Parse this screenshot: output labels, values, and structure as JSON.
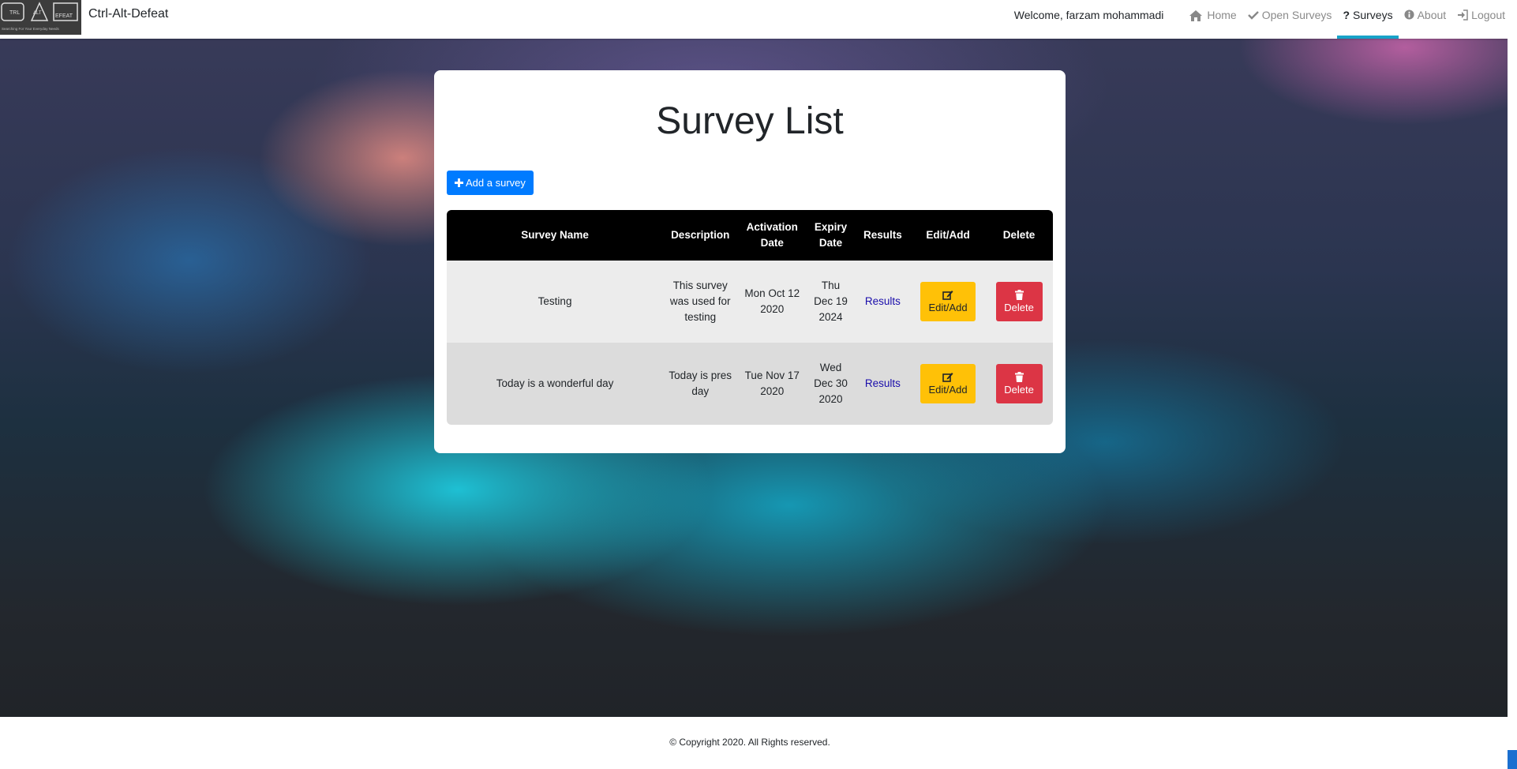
{
  "app": {
    "brand": "Ctrl-Alt-Defeat",
    "logo_text": [
      "TRL",
      "ALT",
      "EFEAT"
    ],
    "logo_tagline": "Searching For Your Everyday Needs"
  },
  "nav": {
    "welcome": "Welcome, farzam mohammadi",
    "items": [
      {
        "label": "Home",
        "icon": "home-icon"
      },
      {
        "label": "Open Surveys",
        "icon": "check-icon"
      },
      {
        "label": "Surveys",
        "icon": "question-icon",
        "active": true
      },
      {
        "label": "About",
        "icon": "info-icon"
      },
      {
        "label": "Logout",
        "icon": "sign-in-icon"
      }
    ]
  },
  "page": {
    "title": "Survey List",
    "add_button": "Add a survey"
  },
  "table": {
    "headers": {
      "name": "Survey Name",
      "description": "Description",
      "activation": "Activation Date",
      "expiry": "Expiry Date",
      "results": "Results",
      "edit": "Edit/Add",
      "delete": "Delete"
    },
    "rows": [
      {
        "name": "Testing",
        "description": "This survey was used for testing",
        "activation": "Mon Oct 12 2020",
        "expiry": "Thu Dec 19 2024",
        "results": "Results",
        "edit": "Edit/Add",
        "delete": "Delete"
      },
      {
        "name": "Today is a wonderful day",
        "description": "Today is pres day",
        "activation": "Tue Nov 17 2020",
        "expiry": "Wed Dec 30 2020",
        "results": "Results",
        "edit": "Edit/Add",
        "delete": "Delete"
      }
    ]
  },
  "footer": {
    "copyright": "© Copyright 2020. All Rights reserved."
  },
  "colors": {
    "primary": "#007bff",
    "warning": "#ffc107",
    "danger": "#dc3545",
    "active_underline": "#17a2c8"
  }
}
